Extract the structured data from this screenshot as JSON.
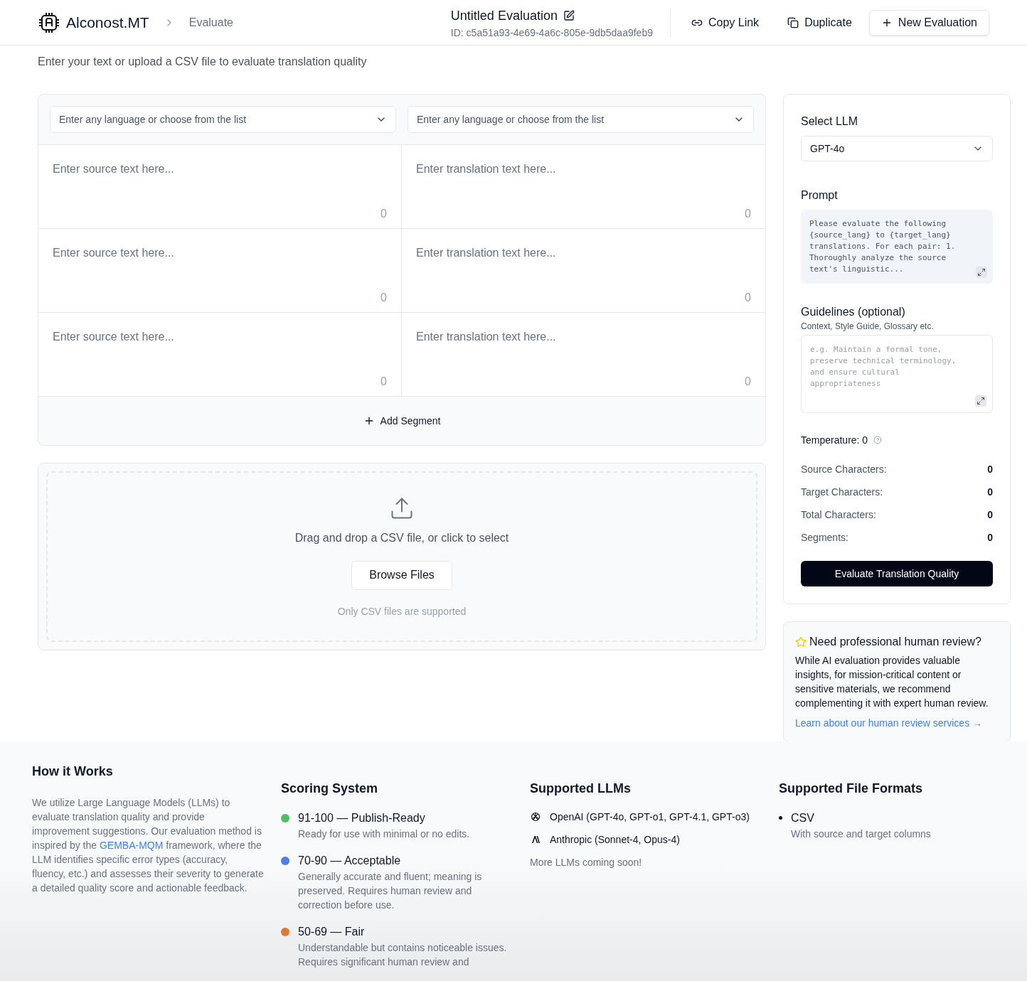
{
  "header": {
    "brand": "Alconost.MT",
    "breadcrumb": "Evaluate",
    "title": "Untitled Evaluation",
    "id_text": "ID: c5a51a93-4e69-4a6c-805e-9db5daa9feb9",
    "actions": [
      {
        "label": "Copy Link",
        "kind": "link"
      },
      {
        "label": "Duplicate",
        "kind": "copy"
      },
      {
        "label": "New Evaluation",
        "kind": "new"
      }
    ]
  },
  "subtitle": "Enter your text or upload a CSV file to evaluate translation quality",
  "languages": [
    {
      "placeholder": "Enter any language or choose from the list"
    },
    {
      "placeholder": "Enter any language or choose from the list"
    }
  ],
  "segments": [
    {
      "source_placeholder": "Enter source text here...",
      "source_count": "0",
      "target_placeholder": "Enter translation text here...",
      "target_count": "0"
    },
    {
      "source_placeholder": "Enter source text here...",
      "source_count": "0",
      "target_placeholder": "Enter translation text here...",
      "target_count": "0"
    },
    {
      "source_placeholder": "Enter source text here...",
      "source_count": "0",
      "target_placeholder": "Enter translation text here...",
      "target_count": "0"
    }
  ],
  "add_segment": "Add Segment",
  "upload": {
    "prompt": "Drag and drop a CSV file, or click to select",
    "button": "Browse Files",
    "note": "Only CSV files are supported"
  },
  "settings": {
    "llm_label": "Select LLM",
    "llm_value": "GPT-4o",
    "prompt_label": "Prompt",
    "prompt_text": "Please evaluate the following {source_lang} to {target_lang} translations. For each pair: 1. Thoroughly analyze the source text's linguistic...",
    "guidelines_label": "Guidelines (optional)",
    "guidelines_hint": "Context, Style Guide, Glossary etc.",
    "guidelines_placeholder": "e.g. Maintain a formal tone, preserve technical terminology, and ensure cultural appropriateness",
    "temperature": "Temperature: 0",
    "stats": [
      {
        "label": "Source Characters:",
        "value": "0"
      },
      {
        "label": "Target Characters:",
        "value": "0"
      },
      {
        "label": "Total Characters:",
        "value": "0"
      },
      {
        "label": "Segments:",
        "value": "0"
      }
    ],
    "evaluate_button": "Evaluate Translation Quality"
  },
  "review": {
    "title": "Need professional human review?",
    "body": "While AI evaluation provides valuable insights, for mission-critical content or sensitive materials, we recommend complementing it with expert human review.",
    "link": "Learn about our human review services →"
  },
  "footer": {
    "how": {
      "title": "How it Works",
      "before": "We utilize Large Language Models (LLMs) to evaluate translation quality and provide improvement suggestions. Our evaluation method is inspired by the ",
      "link": "GEMBA-MQM",
      "after": " framework, where the LLM identifies specific error types (accuracy, fluency, etc.) and assesses their severity to generate a detailed quality score and actionable feedback."
    },
    "scoring": {
      "title": "Scoring System",
      "items": [
        {
          "label": "91-100 — Publish-Ready",
          "description": "Ready for use with minimal or no edits.",
          "color": "#4fbf5c"
        },
        {
          "label": "70-90 — Acceptable",
          "description": "Generally accurate and fluent; meaning is preserved. Requires human review and correction before use.",
          "color": "#4a80ee"
        },
        {
          "label": "50-69 — Fair",
          "description": "Understandable but contains noticeable issues. Requires significant human review and",
          "color": "#e5782e"
        }
      ]
    },
    "llms": {
      "title": "Supported LLMs",
      "items": [
        {
          "label": "OpenAI (GPT-4o, GPT-o1, GPT-4.1, GPT-o3)",
          "kind": "openai"
        },
        {
          "label": "Anthropic (Sonnet-4, Opus-4)",
          "kind": "anthropic"
        }
      ],
      "note": "More LLMs coming soon!"
    },
    "formats": {
      "title": "Supported File Formats",
      "items": [
        {
          "label": "CSV",
          "description": "With source and target columns"
        }
      ]
    }
  }
}
